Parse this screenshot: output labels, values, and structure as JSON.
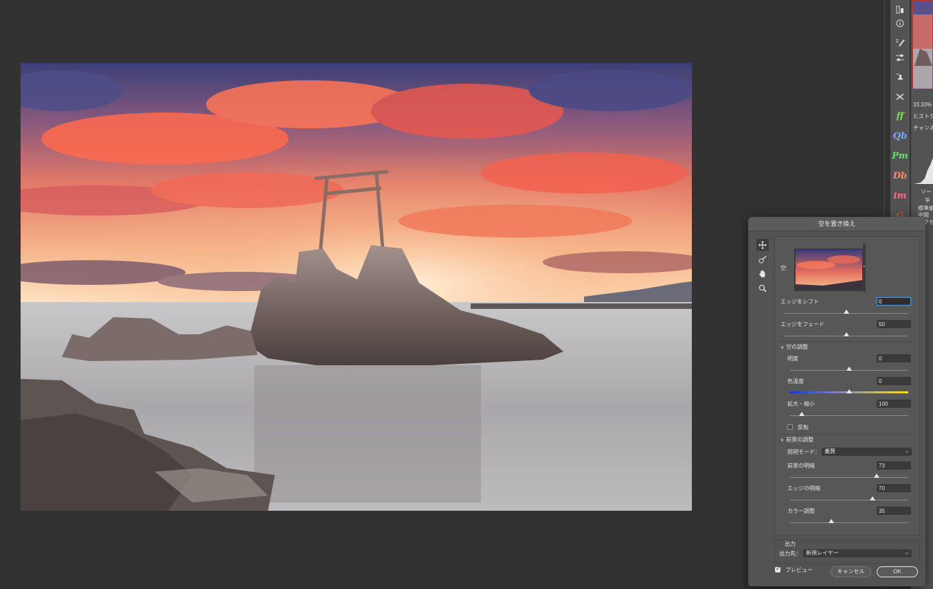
{
  "dialog": {
    "title": "空を置き換え",
    "sky_label": "空:",
    "shift_edge": {
      "label": "エッジをシフト",
      "value": "0",
      "level": 0.5
    },
    "fade_edge": {
      "label": "エッジをフェード",
      "value": "50",
      "level": 0.5
    },
    "sky_adjust": {
      "section": "空の調整",
      "brightness": {
        "label": "明度",
        "value": "0",
        "level": 0.5
      },
      "temperature": {
        "label": "色温度",
        "value": "0",
        "level": 0.5
      },
      "scale": {
        "label": "拡大・縮小",
        "value": "100",
        "level": 0.1
      },
      "flip_label": "反転"
    },
    "foreground_adjust": {
      "section": "前景の調整",
      "lighting_mode_label": "照明モード：",
      "lighting_mode_value": "乗算",
      "fg_lighting": {
        "label": "前景の明暗",
        "value": "73",
        "level": 0.73
      },
      "edge_lighting": {
        "label": "エッジの明暗",
        "value": "70",
        "level": 0.7
      },
      "color_adjust": {
        "label": "カラー調整",
        "value": "35",
        "level": 0.35
      }
    },
    "output": {
      "section": "出力",
      "target_label": "出力先：",
      "target_value": "新規レイヤー"
    },
    "preview_label": "プレビュー",
    "cancel_label": "キャンセル",
    "ok_label": "OK"
  },
  "side_panel": {
    "zoom": "33.33%",
    "histogram_tab": "ヒストグ",
    "channel_label": "チャンネ",
    "source_label": "ソー",
    "mean_label": "平",
    "std_label": "標準偏",
    "median_label": "中間",
    "pixels_label": "ピクセ"
  },
  "tool_strip": {
    "icons": [
      "layer-comps-icon",
      "info-icon",
      "brush-presets-icon",
      "adjustments-icon",
      "clone-source-icon",
      "tool-presets-icon",
      "ff",
      "Qb",
      "Pm",
      "Db",
      "im",
      "G"
    ]
  },
  "colors": {
    "accent_ff": "#7ed957",
    "accent_qb": "#7fa7ff",
    "accent_pm": "#6fdc6f",
    "accent_db": "#ff8a65",
    "accent_im": "#ff6f8f",
    "accent_g": "#e0463a"
  }
}
